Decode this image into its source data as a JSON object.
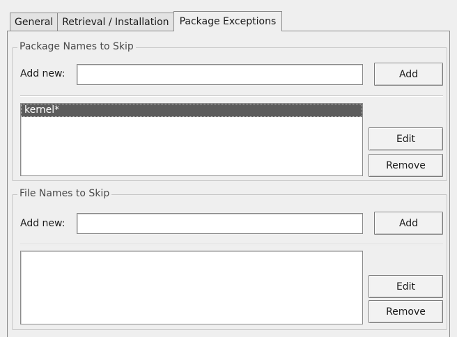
{
  "tabs": [
    {
      "label": "General",
      "active": false
    },
    {
      "label": "Retrieval / Installation",
      "active": false
    },
    {
      "label": "Package Exceptions",
      "active": true
    }
  ],
  "package_section": {
    "title": "Package Names to Skip",
    "add_label": "Add new:",
    "add_value": "",
    "add_button": "Add",
    "items": [
      {
        "name": "kernel*",
        "selected": true
      }
    ],
    "edit_button": "Edit",
    "remove_button": "Remove"
  },
  "file_section": {
    "title": "File Names to Skip",
    "add_label": "Add new:",
    "add_value": "",
    "add_button": "Add",
    "items": [],
    "edit_button": "Edit",
    "remove_button": "Remove"
  },
  "colors": {
    "window_bg": "#efefef",
    "selection_bg": "#5c5c5c",
    "selection_fg": "#ffffff",
    "border": "#8a8a8a"
  }
}
